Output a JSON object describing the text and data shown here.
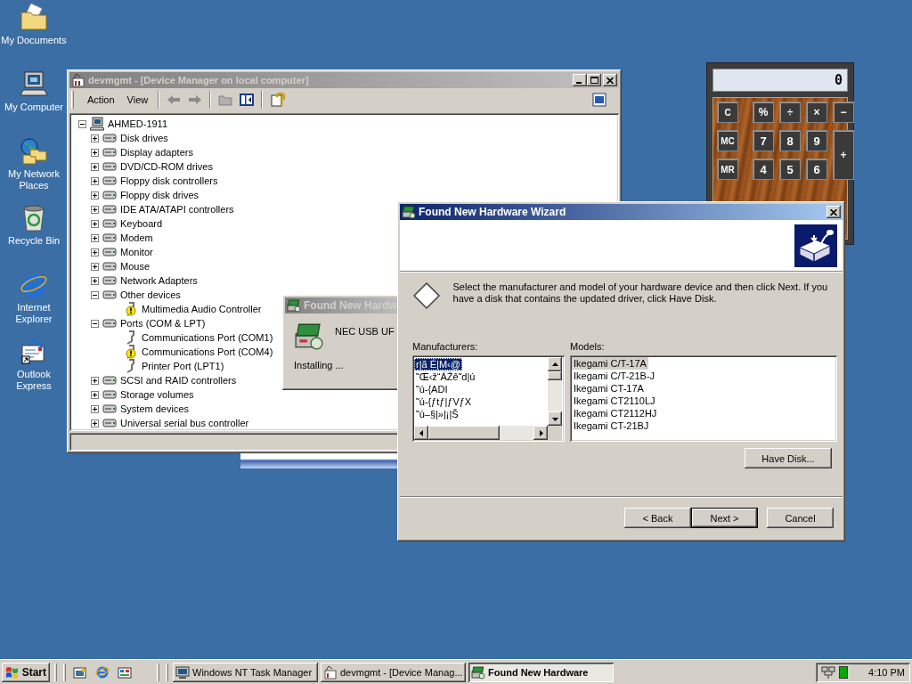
{
  "desktop_icons": [
    {
      "label": "My Documents"
    },
    {
      "label": "My Computer"
    },
    {
      "label": "My Network Places"
    },
    {
      "label": "Recycle Bin"
    },
    {
      "label": "Internet Explorer"
    },
    {
      "label": "Outlook Express"
    }
  ],
  "device_manager": {
    "title": "devmgmt - [Device Manager on local computer]",
    "active": false,
    "menu": [
      "Action",
      "View"
    ],
    "tree": {
      "label": "AHMED-1911",
      "expanded": true,
      "children": [
        {
          "label": "Disk drives",
          "expanded": false
        },
        {
          "label": "Display adapters",
          "expanded": false
        },
        {
          "label": "DVD/CD-ROM drives",
          "expanded": false
        },
        {
          "label": "Floppy disk controllers",
          "expanded": false
        },
        {
          "label": "Floppy disk drives",
          "expanded": false
        },
        {
          "label": "IDE ATA/ATAPI controllers",
          "expanded": false
        },
        {
          "label": "Keyboard",
          "expanded": false
        },
        {
          "label": "Modem",
          "expanded": false
        },
        {
          "label": "Monitor",
          "expanded": false
        },
        {
          "label": "Mouse",
          "expanded": false
        },
        {
          "label": "Network Adapters",
          "expanded": false
        },
        {
          "label": "Other devices",
          "expanded": true,
          "children": [
            {
              "label": "Multimedia Audio Controller",
              "warning": true
            }
          ]
        },
        {
          "label": "Ports (COM & LPT)",
          "expanded": true,
          "children": [
            {
              "label": "Communications Port (COM1)",
              "warning": false
            },
            {
              "label": "Communications Port (COM4)",
              "warning": true
            },
            {
              "label": "Printer Port (LPT1)",
              "warning": false
            }
          ]
        },
        {
          "label": "SCSI and RAID controllers",
          "expanded": false
        },
        {
          "label": "Storage volumes",
          "expanded": false
        },
        {
          "label": "System devices",
          "expanded": false
        },
        {
          "label": "Universal serial bus controller",
          "expanded": false
        }
      ]
    }
  },
  "calculator": {
    "display": "0",
    "keys": [
      {
        "label": "C",
        "kind": "mem"
      },
      {
        "label": "%",
        "kind": "op"
      },
      {
        "label": "÷",
        "kind": "op"
      },
      {
        "label": "×",
        "kind": "op"
      },
      {
        "label": "−",
        "kind": "op"
      },
      {
        "label": "MC",
        "kind": "mem"
      },
      {
        "label": "7",
        "kind": "digit"
      },
      {
        "label": "8",
        "kind": "digit"
      },
      {
        "label": "9",
        "kind": "digit"
      },
      {
        "label": "+",
        "kind": "op",
        "tall": true
      },
      {
        "label": "MR",
        "kind": "mem"
      },
      {
        "label": "4",
        "kind": "digit"
      },
      {
        "label": "5",
        "kind": "digit"
      },
      {
        "label": "6",
        "kind": "digit"
      }
    ]
  },
  "install_popup": {
    "title": "Found New Hardw",
    "active": false,
    "device": "NEC USB UF",
    "status": "Installing ..."
  },
  "wizard": {
    "title": "Found New Hardware Wizard",
    "active": true,
    "instruction": "Select the manufacturer and model of your hardware device and then click Next. If you have a disk that contains the updated driver, click Have Disk.",
    "manufacturers": {
      "label": "Manufacturers:",
      "focused": true,
      "items": [
        {
          "label": "r|ã É|M‹@",
          "selected": true
        },
        {
          "label": "˜Œ‹ž“ÁŽê˜d|ú",
          "selected": false
        },
        {
          "label": "˜ú-{ADI",
          "selected": false
        },
        {
          "label": "˜ú-{ƒtƒ|ƒVƒX",
          "selected": false
        },
        {
          "label": "˜ú–§|»|¡|Š",
          "selected": false
        }
      ]
    },
    "models": {
      "label": "Models:",
      "focused": false,
      "items": [
        {
          "label": "Ikegami C/T-17A",
          "selected": true
        },
        {
          "label": "Ikegami C/T-21B-J",
          "selected": false
        },
        {
          "label": "Ikegami CT-17A",
          "selected": false
        },
        {
          "label": "Ikegami CT2110LJ",
          "selected": false
        },
        {
          "label": "Ikegami CT2112HJ",
          "selected": false
        },
        {
          "label": "Ikegami CT-21BJ",
          "selected": false
        }
      ]
    },
    "have_disk": "Have Disk...",
    "buttons": [
      {
        "label": "< Back",
        "default": false
      },
      {
        "label": "Next >",
        "default": true
      },
      {
        "label": "Cancel",
        "default": false
      }
    ]
  },
  "taskbar": {
    "start": "Start",
    "tasks": [
      {
        "label": "Windows NT Task Manager",
        "selected": false
      },
      {
        "label": "devmgmt - [Device Manag...",
        "selected": false
      },
      {
        "label": "Found New Hardware",
        "selected": true
      }
    ],
    "clock": "4:10 PM"
  }
}
